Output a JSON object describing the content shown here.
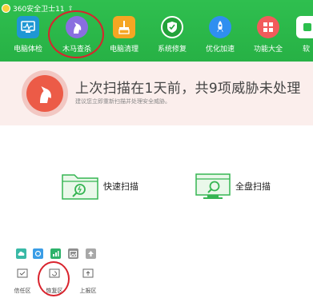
{
  "app": {
    "title": "360安全卫士11"
  },
  "nav": {
    "items": [
      {
        "label": "电脑体检",
        "color": "#1f97d4",
        "icon": "monitor-icon"
      },
      {
        "label": "木马查杀",
        "color": "#8a6fe0",
        "icon": "horse-icon"
      },
      {
        "label": "电脑清理",
        "color": "#f5a623",
        "icon": "broom-icon"
      },
      {
        "label": "系统修复",
        "color": "#23a23a",
        "icon": "shield-icon"
      },
      {
        "label": "优化加速",
        "color": "#2f8ff0",
        "icon": "rocket-icon"
      },
      {
        "label": "功能大全",
        "color": "#f25b5b",
        "icon": "grid-icon"
      },
      {
        "label": "软",
        "color": "#2cbf4d",
        "icon": "app-icon"
      }
    ]
  },
  "alert": {
    "title": "上次扫描在1天前，共9项威胁未处理",
    "subtitle": "建议您立即重新扫描并处理安全威胁。"
  },
  "scan": {
    "quick_label": "快速扫描",
    "full_label": "全盘扫描"
  },
  "tiny_tools": [
    {
      "icon": "cloud-icon",
      "color": "#39b9a6"
    },
    {
      "icon": "refresh-icon",
      "color": "#3a9de6"
    },
    {
      "icon": "chart-icon",
      "color": "#2db26a"
    },
    {
      "icon": "image-icon",
      "color": "#8f8f8f"
    },
    {
      "icon": "upload-icon",
      "color": "#a8a8a8"
    }
  ],
  "bottom_tools": [
    {
      "label": "信任区",
      "icon": "trust-zone-icon"
    },
    {
      "label": "恢复区",
      "icon": "restore-zone-icon"
    },
    {
      "label": "上报区",
      "icon": "report-zone-icon"
    }
  ]
}
